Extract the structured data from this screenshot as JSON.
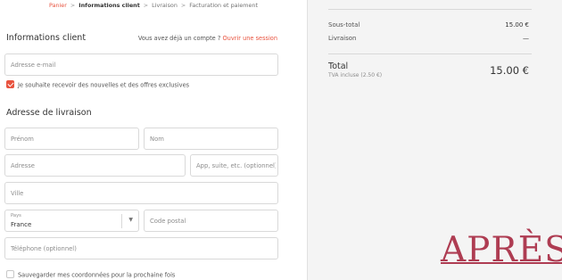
{
  "breadcrumb": {
    "cart": "Panier",
    "info": "Informations client",
    "shipping": "Livraison",
    "payment": "Facturation et paiement",
    "separator": ">"
  },
  "contact": {
    "title": "Informations client",
    "login_prompt": "Vous avez déjà un compte ?",
    "login_link": "Ouvrir une session",
    "email_placeholder": "Adresse e-mail",
    "newsletter_label": "Je souhaite recevoir des nouvelles et des offres exclusives",
    "newsletter_checked": true
  },
  "shipping": {
    "title": "Adresse de livraison",
    "first_name_placeholder": "Prénom",
    "last_name_placeholder": "Nom",
    "address_placeholder": "Adresse",
    "apartment_placeholder": "App, suite, etc. (optionnel)",
    "city_placeholder": "Ville",
    "country_label": "Pays",
    "country_value": "France",
    "postal_placeholder": "Code postal",
    "phone_placeholder": "Téléphone (optionnel)",
    "save_label": "Sauvegarder mes coordonnées pour la prochaine fois",
    "save_checked": false
  },
  "summary": {
    "subtotal_label": "Sous-total",
    "subtotal_value": "15.00 €",
    "shipping_label": "Livraison",
    "shipping_value": "—",
    "total_label": "Total",
    "tax_note": "TVA incluse (2.50 €)",
    "total_value": "15.00 €"
  },
  "watermark": {
    "text": "APRÈS"
  },
  "colors": {
    "accent": "#e8533f",
    "watermark": "#ae3c52",
    "sidebar_bg": "#f4f4f4"
  }
}
